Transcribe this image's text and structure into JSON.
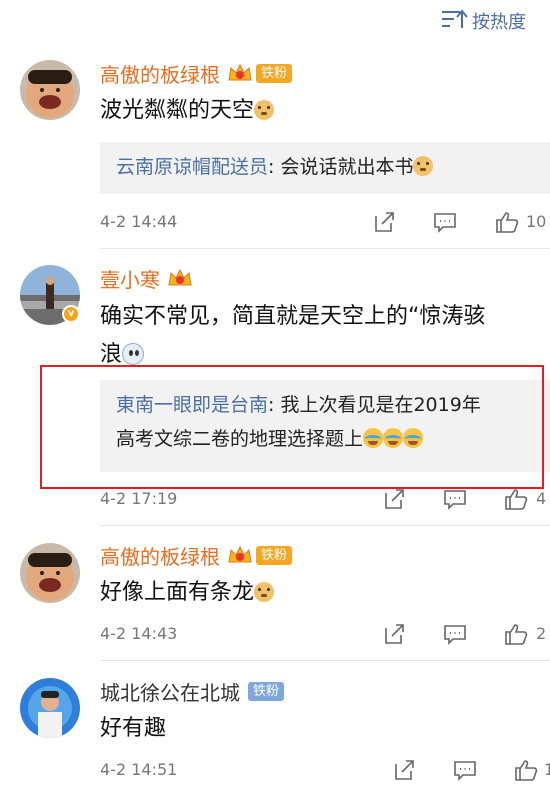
{
  "sort": {
    "label": "按热度"
  },
  "comments": [
    {
      "username": "高傲的板绿根",
      "badge": "铁粉",
      "text": "波光粼粼的天空",
      "reply": {
        "user": "云南原谅帽配送员",
        "text": "会说话就出本书"
      },
      "time": "4-2 14:44",
      "likes": "10"
    },
    {
      "username": "壹小寒",
      "text_line1": "确实不常见，简直就是天空上的“惊涛骇",
      "text_line2": "浪",
      "reply": {
        "user": "東南一眼即是台南",
        "text_line1": "我上次看见是在2019年",
        "text_line2": "高考文综二卷的地理选择题上"
      },
      "time": "4-2 17:19",
      "likes": "4"
    },
    {
      "username": "高傲的板绿根",
      "badge": "铁粉",
      "text": "好像上面有条龙",
      "time": "4-2 14:43",
      "likes": "2"
    },
    {
      "username": "城北徐公在北城",
      "badge": "铁粉",
      "text": "好有趣",
      "time": "4-2 14:51",
      "likes": "1"
    }
  ],
  "icons": {
    "sort": "sort-lines-icon",
    "share": "share-icon",
    "reply": "comment-icon",
    "like": "thumbs-up-icon",
    "crown": "crown-icon"
  },
  "colors": {
    "username_vip": "#e86d1f",
    "reply_user": "#4a6fa5",
    "badge_orange": "#f6a623",
    "badge_blue": "#7ea7de",
    "highlight": "#e02020"
  }
}
